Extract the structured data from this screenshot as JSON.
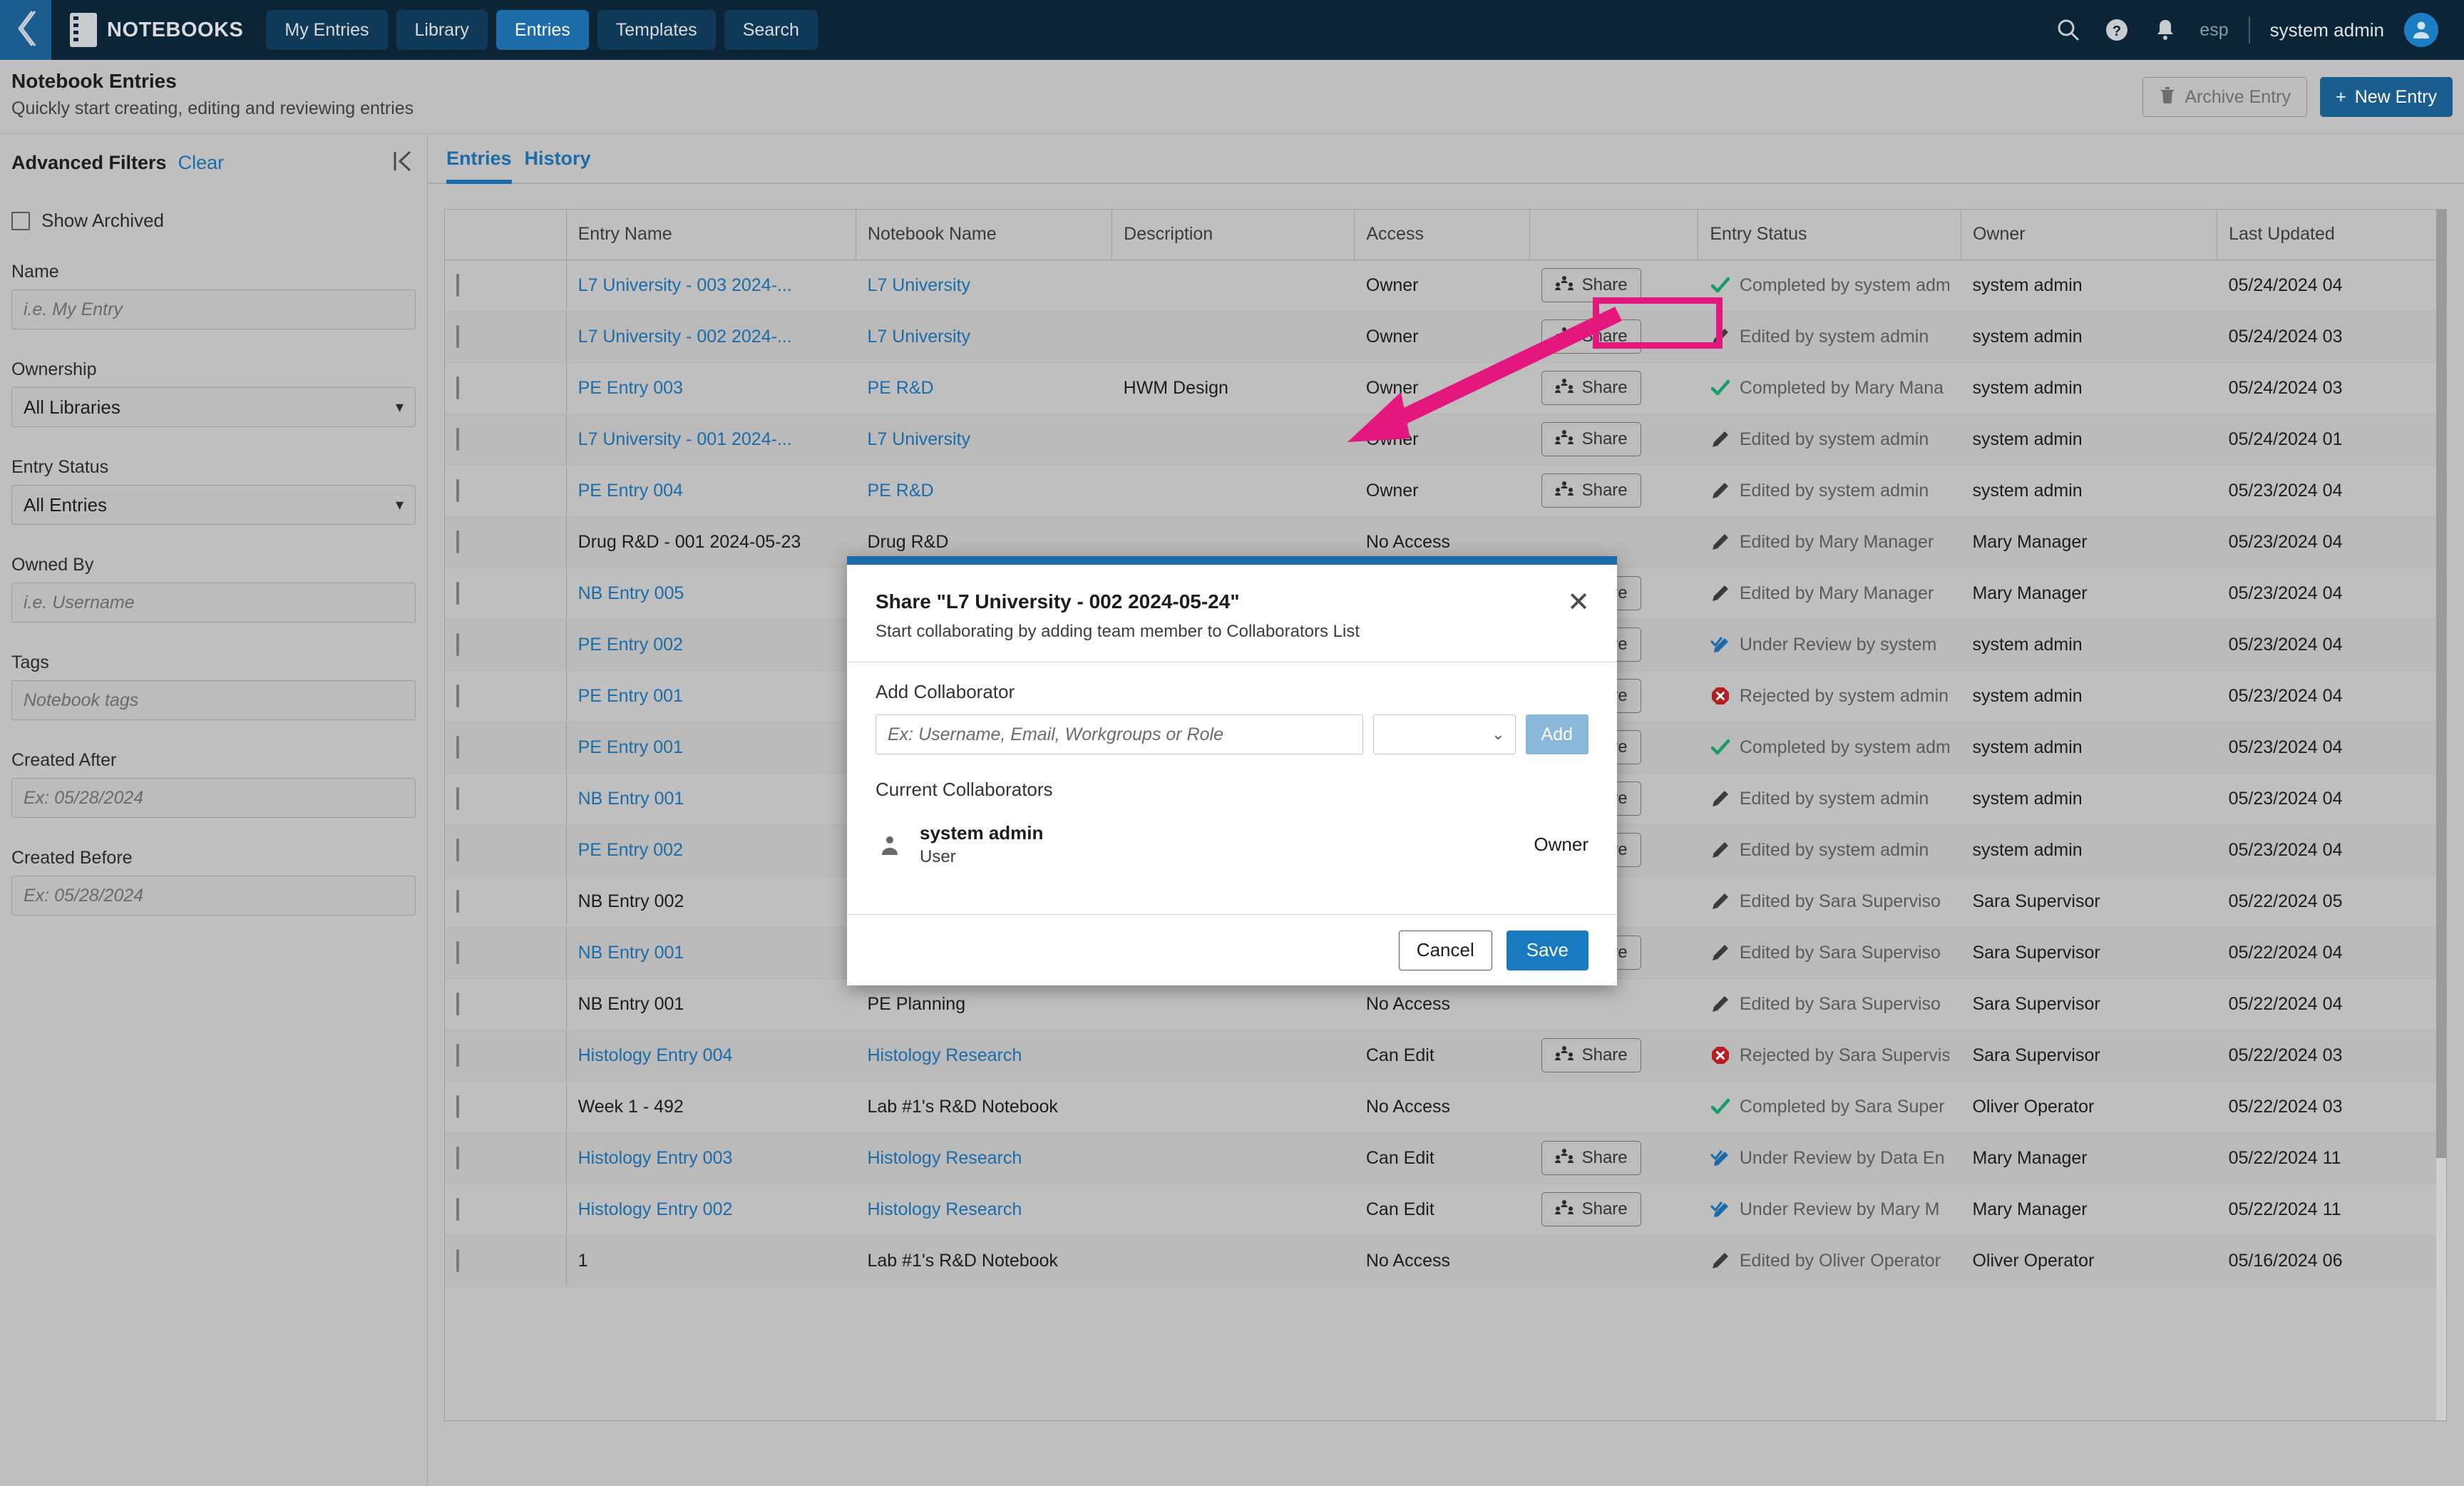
{
  "topnav": {
    "back_icon": "chevron-left-icon",
    "brand": "NOTEBOOKS",
    "tabs": [
      {
        "label": "My Entries",
        "active": false
      },
      {
        "label": "Library",
        "active": false
      },
      {
        "label": "Entries",
        "active": true
      },
      {
        "label": "Templates",
        "active": false
      },
      {
        "label": "Search",
        "active": false
      }
    ],
    "icons": [
      "search-icon",
      "help-icon",
      "notifications-bell-icon"
    ],
    "language": "esp",
    "user": "system admin"
  },
  "pagehead": {
    "title": "Notebook Entries",
    "subtitle": "Quickly start creating, editing and reviewing entries",
    "archive_label": "Archive Entry",
    "new_label": "New Entry",
    "new_plus": "+"
  },
  "sidebar": {
    "title": "Advanced Filters",
    "clear": "Clear",
    "collapse_icon": "collapse-panel-icon",
    "show_archived": "Show Archived",
    "fields": [
      {
        "label": "Name",
        "type": "input",
        "value": "",
        "placeholder": "i.e. My Entry"
      },
      {
        "label": "Ownership",
        "type": "select",
        "value": "All Libraries"
      },
      {
        "label": "Entry Status",
        "type": "select",
        "value": "All Entries"
      },
      {
        "label": "Owned By",
        "type": "input",
        "value": "",
        "placeholder": "i.e. Username"
      },
      {
        "label": "Tags",
        "type": "input",
        "value": "",
        "placeholder": "Notebook tags"
      },
      {
        "label": "Created After",
        "type": "input",
        "value": "",
        "placeholder": "Ex: 05/28/2024"
      },
      {
        "label": "Created Before",
        "type": "input",
        "value": "",
        "placeholder": "Ex: 05/28/2024"
      }
    ]
  },
  "main": {
    "tabs": [
      {
        "label": "Entries",
        "active": true
      },
      {
        "label": "History",
        "active": false
      }
    ],
    "columns": [
      "",
      "Entry Name",
      "Notebook Name",
      "Description",
      "Access",
      "",
      "Entry Status",
      "Owner",
      "Last Updated"
    ],
    "share_label": "Share",
    "rows": [
      {
        "name": "L7 University - 003 2024-...",
        "name_link": true,
        "notebook": "L7 University",
        "notebook_link": true,
        "description": "",
        "access": "Owner",
        "share": true,
        "status": "Completed by system adm",
        "status_icon": "check-icon",
        "owner": "system admin",
        "updated": "05/24/2024 04"
      },
      {
        "name": "L7 University - 002 2024-...",
        "name_link": true,
        "notebook": "L7 University",
        "notebook_link": true,
        "description": "",
        "access": "Owner",
        "share": true,
        "status": "Edited by system admin",
        "status_icon": "pencil-icon",
        "owner": "system admin",
        "updated": "05/24/2024 03"
      },
      {
        "name": "PE Entry 003",
        "name_link": true,
        "notebook": "PE R&D",
        "notebook_link": true,
        "description": "HWM Design",
        "access": "Owner",
        "share": true,
        "status": "Completed by Mary Mana",
        "status_icon": "check-icon",
        "owner": "system admin",
        "updated": "05/24/2024 03"
      },
      {
        "name": "L7 University - 001 2024-...",
        "name_link": true,
        "notebook": "L7 University",
        "notebook_link": true,
        "description": "",
        "access": "Owner",
        "share": true,
        "status": "Edited by system admin",
        "status_icon": "pencil-icon",
        "owner": "system admin",
        "updated": "05/24/2024 01"
      },
      {
        "name": "PE Entry 004",
        "name_link": true,
        "notebook": "PE R&D",
        "notebook_link": true,
        "description": "",
        "access": "Owner",
        "share": true,
        "status": "Edited by system admin",
        "status_icon": "pencil-icon",
        "owner": "system admin",
        "updated": "05/23/2024 04"
      },
      {
        "name": "Drug R&D - 001 2024-05-23",
        "name_link": false,
        "notebook": "Drug R&D",
        "notebook_link": false,
        "description": "",
        "access": "No Access",
        "share": false,
        "status": "Edited by Mary Manager",
        "status_icon": "pencil-icon",
        "owner": "Mary Manager",
        "updated": "05/23/2024 04"
      },
      {
        "name": "NB Entry 005",
        "name_link": true,
        "notebook": "",
        "notebook_link": false,
        "description": "",
        "access": "",
        "share": true,
        "status": "Edited by Mary Manager",
        "status_icon": "pencil-icon",
        "owner": "Mary Manager",
        "updated": "05/23/2024 04"
      },
      {
        "name": "PE Entry 002",
        "name_link": true,
        "notebook": "",
        "notebook_link": false,
        "description": "",
        "access": "",
        "share": true,
        "status": "Under Review by system",
        "status_icon": "review-icon",
        "owner": "system admin",
        "updated": "05/23/2024 04"
      },
      {
        "name": "PE Entry 001",
        "name_link": true,
        "notebook": "",
        "notebook_link": false,
        "description": "",
        "access": "",
        "share": true,
        "status": "Rejected by system admin",
        "status_icon": "rejected-icon",
        "owner": "system admin",
        "updated": "05/23/2024 04"
      },
      {
        "name": "PE Entry 001",
        "name_link": true,
        "notebook": "",
        "notebook_link": false,
        "description": "",
        "access": "",
        "share": true,
        "status": "Completed by system adm",
        "status_icon": "check-icon",
        "owner": "system admin",
        "updated": "05/23/2024 04"
      },
      {
        "name": "NB Entry 001",
        "name_link": true,
        "notebook": "",
        "notebook_link": false,
        "description": "",
        "access": "",
        "share": true,
        "status": "Edited by system admin",
        "status_icon": "pencil-icon",
        "owner": "system admin",
        "updated": "05/23/2024 04"
      },
      {
        "name": "PE Entry 002",
        "name_link": true,
        "notebook": "",
        "notebook_link": false,
        "description": "",
        "access": "",
        "share": true,
        "status": "Edited by system admin",
        "status_icon": "pencil-icon",
        "owner": "system admin",
        "updated": "05/23/2024 04"
      },
      {
        "name": "NB Entry 002",
        "name_link": false,
        "notebook": "",
        "notebook_link": false,
        "description": "",
        "access": "",
        "share": false,
        "status": "Edited by Sara Superviso",
        "status_icon": "pencil-icon",
        "owner": "Sara Supervisor",
        "updated": "05/22/2024 05"
      },
      {
        "name": "NB Entry 001",
        "name_link": true,
        "notebook": "",
        "notebook_link": false,
        "description": "",
        "access": "",
        "share": true,
        "status": "Edited by Sara Superviso",
        "status_icon": "pencil-icon",
        "owner": "Sara Supervisor",
        "updated": "05/22/2024 04"
      },
      {
        "name": "NB Entry 001",
        "name_link": false,
        "notebook": "PE Planning",
        "notebook_link": false,
        "description": "",
        "access": "No Access",
        "share": false,
        "status": "Edited by Sara Superviso",
        "status_icon": "pencil-icon",
        "owner": "Sara Supervisor",
        "updated": "05/22/2024 04"
      },
      {
        "name": "Histology Entry 004",
        "name_link": true,
        "notebook": "Histology Research",
        "notebook_link": true,
        "description": "",
        "access": "Can Edit",
        "share": true,
        "status": "Rejected by Sara Supervis",
        "status_icon": "rejected-icon",
        "owner": "Sara Supervisor",
        "updated": "05/22/2024 03"
      },
      {
        "name": "Week 1 - 492",
        "name_link": false,
        "notebook": "Lab #1's R&D Notebook",
        "notebook_link": false,
        "description": "",
        "access": "No Access",
        "share": false,
        "status": "Completed by Sara Super",
        "status_icon": "check-icon",
        "owner": "Oliver Operator",
        "updated": "05/22/2024 03"
      },
      {
        "name": "Histology Entry 003",
        "name_link": true,
        "notebook": "Histology Research",
        "notebook_link": true,
        "description": "",
        "access": "Can Edit",
        "share": true,
        "status": "Under Review by Data En",
        "status_icon": "review-icon",
        "owner": "Mary Manager",
        "updated": "05/22/2024 11"
      },
      {
        "name": "Histology Entry 002",
        "name_link": true,
        "notebook": "Histology Research",
        "notebook_link": true,
        "description": "",
        "access": "Can Edit",
        "share": true,
        "status": "Under Review by Mary M",
        "status_icon": "review-icon",
        "owner": "Mary Manager",
        "updated": "05/22/2024 11"
      },
      {
        "name": "1",
        "name_link": false,
        "notebook": "Lab #1's R&D Notebook",
        "notebook_link": false,
        "description": "",
        "access": "No Access",
        "share": false,
        "status": "Edited by Oliver Operator",
        "status_icon": "pencil-icon",
        "owner": "Oliver Operator",
        "updated": "05/16/2024 06"
      }
    ]
  },
  "modal": {
    "title": "Share \"L7 University - 002 2024-05-24\"",
    "subtitle": "Start collaborating by adding team member to Collaborators List",
    "close_icon": "close-icon",
    "add_collaborator_label": "Add Collaborator",
    "collaborator_input_value": "",
    "collaborator_input_placeholder": "Ex: Username, Email, Workgroups or Role",
    "role_select_value": "",
    "add_button": "Add",
    "current_collaborators_label": "Current Collaborators",
    "collaborators": [
      {
        "name": "system admin",
        "type": "User",
        "role": "Owner"
      }
    ],
    "cancel_label": "Cancel",
    "save_label": "Save"
  },
  "colors": {
    "nav_bg": "#0b2436",
    "accent_blue": "#1b6ca8",
    "annotation_pink": "#e4177f",
    "status_green": "#199a68",
    "status_red": "#b61f24",
    "page_bg": "#bfbfbf"
  }
}
